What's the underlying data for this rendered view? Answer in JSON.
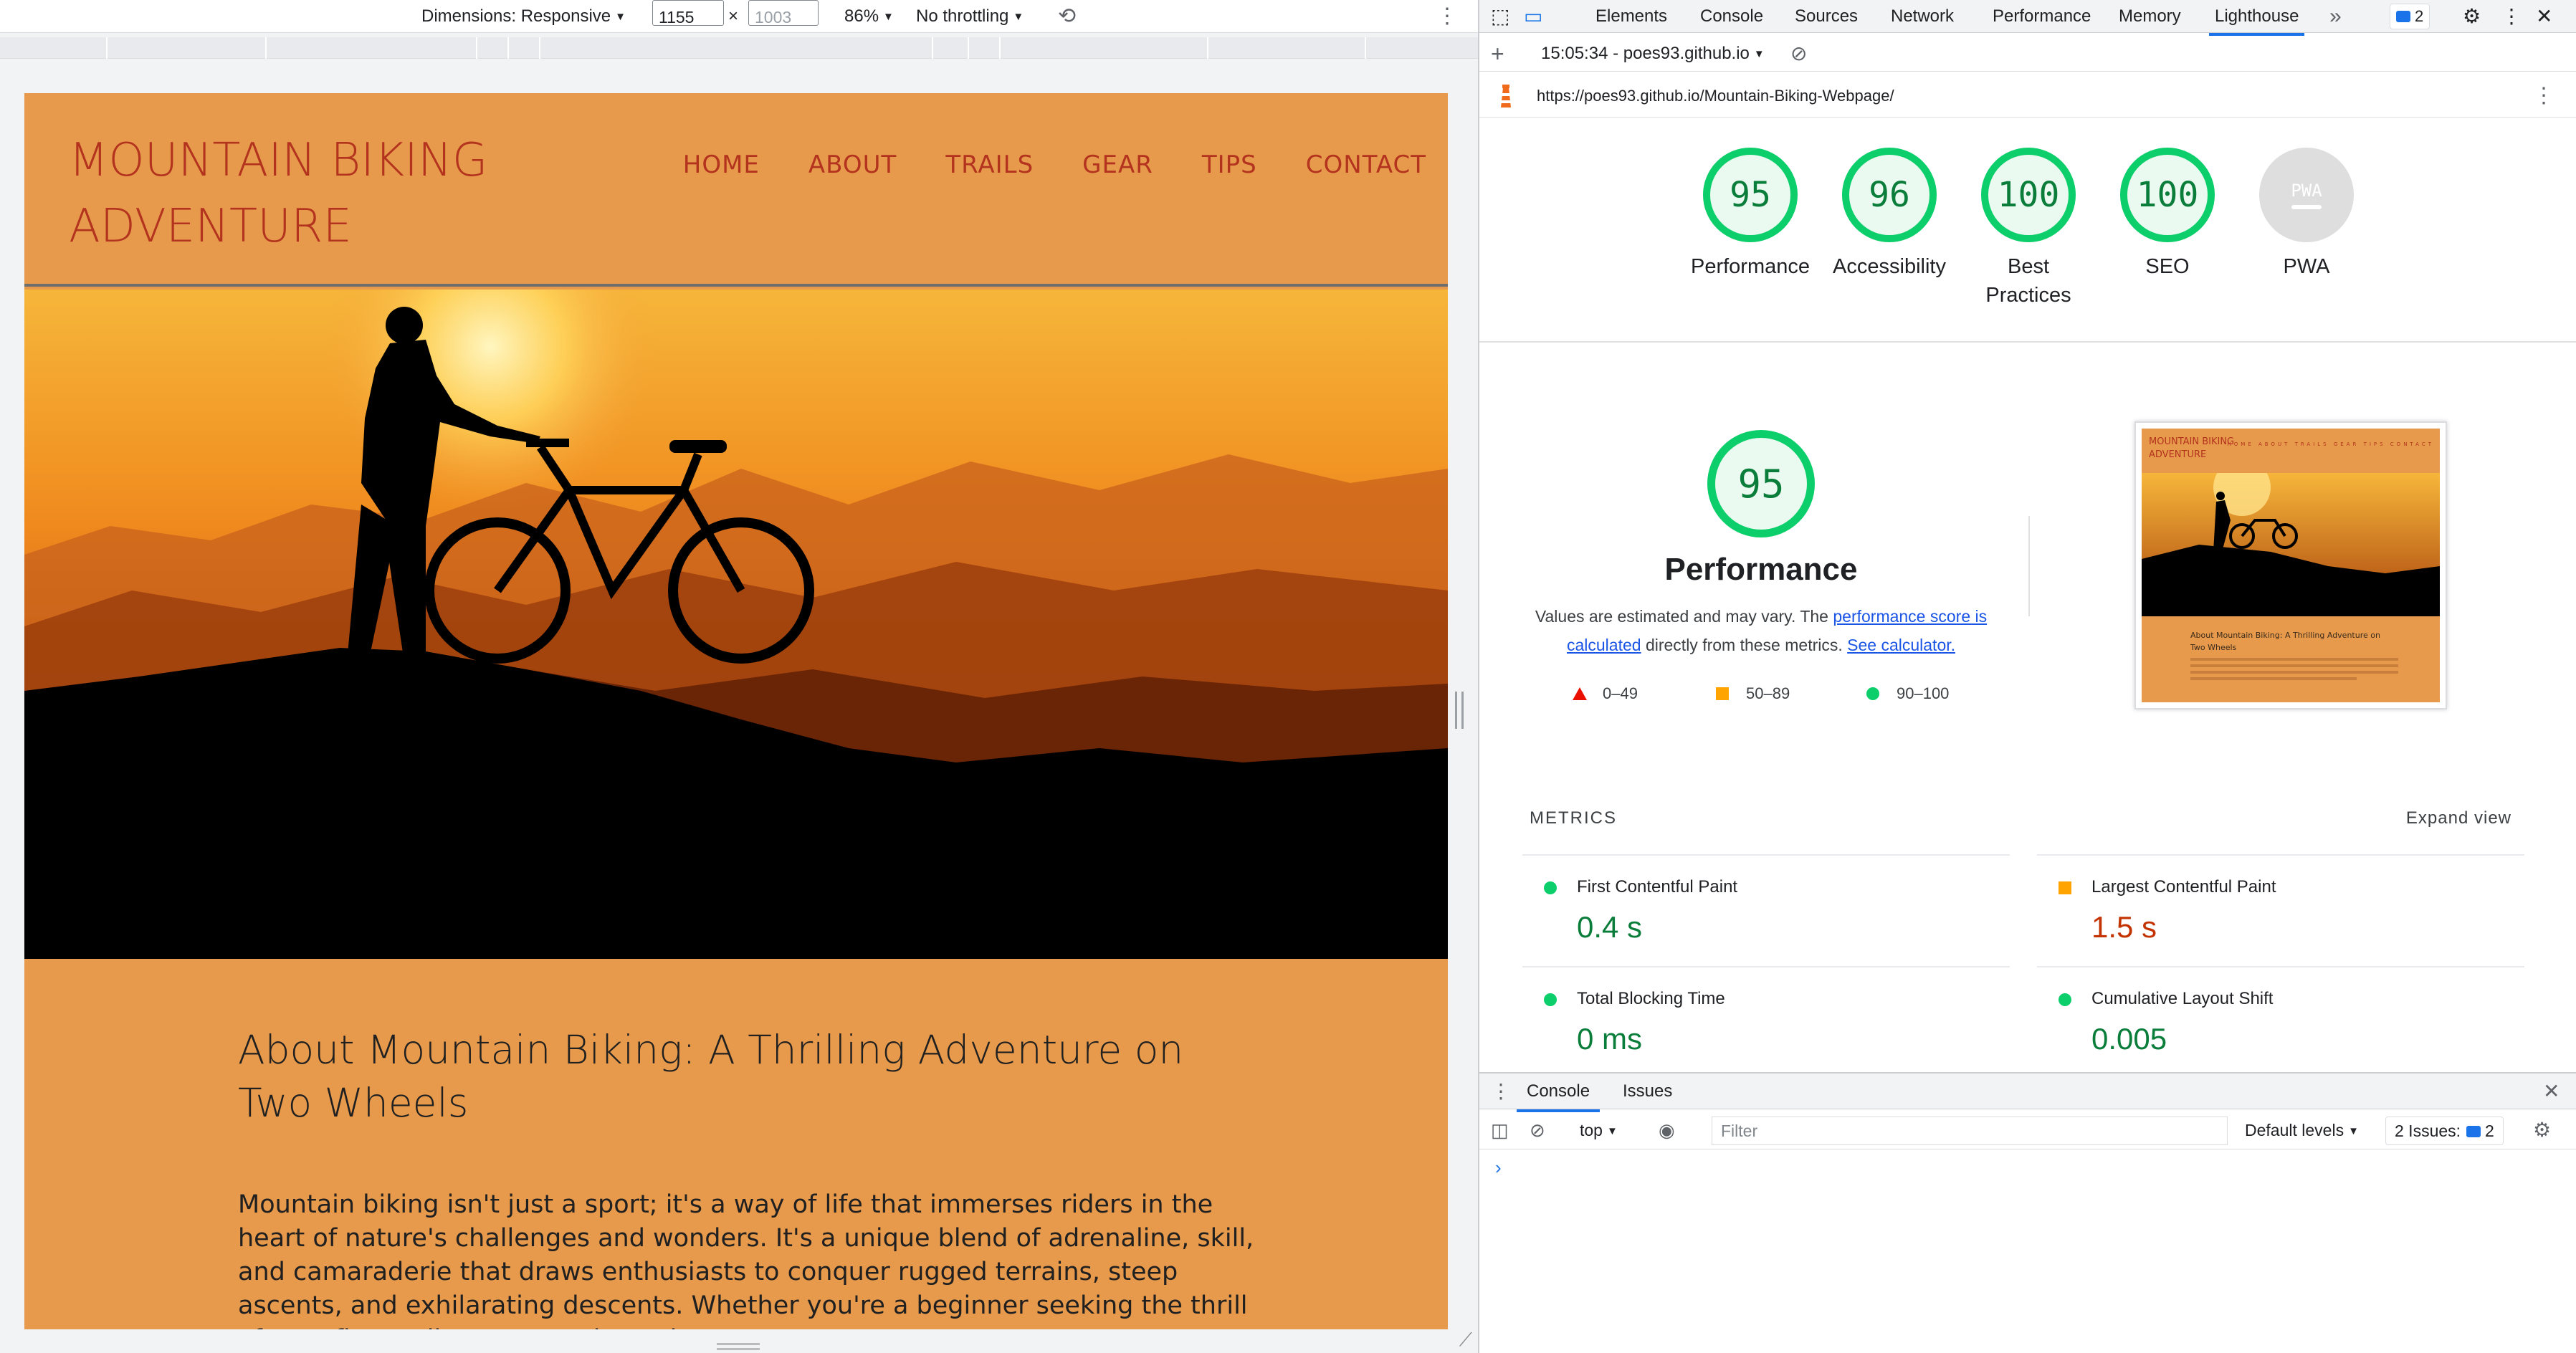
{
  "device_toolbar": {
    "dimensions_label": "Dimensions: Responsive",
    "width_value": "1155",
    "height_placeholder": "1003",
    "times": "×",
    "zoom": "86%",
    "throttling": "No throttling"
  },
  "site": {
    "logo": "MOUNTAIN BIKING ADVENTURE",
    "nav": [
      "HOME",
      "ABOUT",
      "TRAILS",
      "GEAR",
      "TIPS",
      "CONTACT"
    ],
    "about_title": "About Mountain Biking: A Thrilling Adventure on Two Wheels",
    "about_body": "Mountain biking isn't just a sport; it's a way of life that immerses riders in the heart of nature's challenges and wonders. It's a unique blend of adrenaline, skill, and camaraderie that draws enthusiasts to conquer rugged terrains, steep ascents, and exhilarating descents. Whether you're a beginner seeking the thrill of your first trail or an experienced",
    "colors": {
      "background": "#e79a4c",
      "logo": "#b3331e"
    }
  },
  "devtools": {
    "tabs": [
      "Elements",
      "Console",
      "Sources",
      "Network",
      "Performance",
      "Memory",
      "Lighthouse"
    ],
    "active_tab": "Lighthouse",
    "more_tabs": "»",
    "issues_badge": "2",
    "report_time": "15:05:34 - poes93.github.io",
    "url": "https://poes93.github.io/Mountain-Biking-Webpage/",
    "scores": [
      {
        "label": "Performance",
        "value": "95"
      },
      {
        "label": "Accessibility",
        "value": "96"
      },
      {
        "label": "Best Practices",
        "value": "100"
      },
      {
        "label": "SEO",
        "value": "100"
      },
      {
        "label": "PWA",
        "value": "PWA"
      }
    ],
    "performance": {
      "score": "95",
      "title": "Performance",
      "desc_prefix": "Values are estimated and may vary. The ",
      "desc_link1": "performance score is calculated",
      "desc_middle": " directly from these metrics. ",
      "desc_link2": "See calculator.",
      "legend": [
        "0–49",
        "50–89",
        "90–100"
      ]
    },
    "thumbnail": {
      "logo": "MOUNTAIN BIKING ADVENTURE",
      "nav": "HOME ABOUT TRAILS GEAR TIPS CONTACT",
      "title": "About Mountain Biking: A Thrilling Adventure on Two Wheels"
    },
    "metrics": {
      "heading": "METRICS",
      "expand": "Expand view",
      "items": [
        {
          "name": "First Contentful Paint",
          "value": "0.4 s",
          "status": "pass"
        },
        {
          "name": "Largest Contentful Paint",
          "value": "1.5 s",
          "status": "average"
        },
        {
          "name": "Total Blocking Time",
          "value": "0 ms",
          "status": "pass"
        },
        {
          "name": "Cumulative Layout Shift",
          "value": "0.005",
          "status": "pass"
        }
      ]
    },
    "drawer": {
      "tabs": [
        "Console",
        "Issues"
      ],
      "context": "top",
      "filter_placeholder": "Filter",
      "levels": "Default levels",
      "issues_label": "2 Issues:",
      "issues_count": "2",
      "prompt": "›"
    },
    "colors": {
      "pass": "#0cce6b",
      "average": "#ffa400",
      "fail": "#eb0f00",
      "accent": "#1a73e8"
    }
  }
}
